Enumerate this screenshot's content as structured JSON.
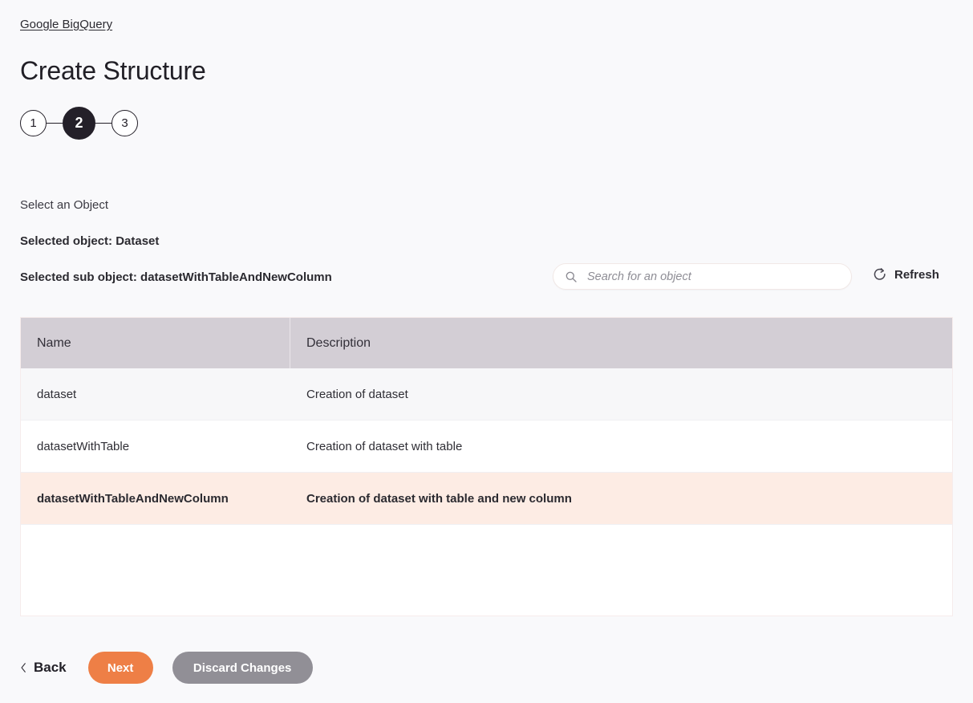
{
  "breadcrumb": {
    "label": "Google BigQuery"
  },
  "page": {
    "title": "Create Structure"
  },
  "stepper": {
    "steps": [
      {
        "label": "1",
        "active": false
      },
      {
        "label": "2",
        "active": true
      },
      {
        "label": "3",
        "active": false
      }
    ]
  },
  "labels": {
    "select_an_object": "Select an Object",
    "selected_object": "Selected object: Dataset",
    "selected_sub_object": "Selected sub object: datasetWithTableAndNewColumn"
  },
  "search": {
    "placeholder": "Search for an object",
    "value": "",
    "icon": "search-icon"
  },
  "refresh": {
    "label": "Refresh",
    "icon": "refresh-icon"
  },
  "table": {
    "columns": [
      "Name",
      "Description"
    ],
    "rows": [
      {
        "name": "dataset",
        "description": "Creation of dataset",
        "selected": false
      },
      {
        "name": "datasetWithTable",
        "description": "Creation of dataset with table",
        "selected": false
      },
      {
        "name": "datasetWithTableAndNewColumn",
        "description": "Creation of dataset with table and new column",
        "selected": true
      }
    ]
  },
  "footer": {
    "back_label": "Back",
    "next_label": "Next",
    "discard_label": "Discard Changes"
  },
  "colors": {
    "accent_orange": "#EE7F46",
    "discard_gray": "#918F96",
    "selected_row": "#FDECE4",
    "header_bg": "#D3CED5",
    "page_bg": "#F9F9FB",
    "step_active": "#242029"
  }
}
